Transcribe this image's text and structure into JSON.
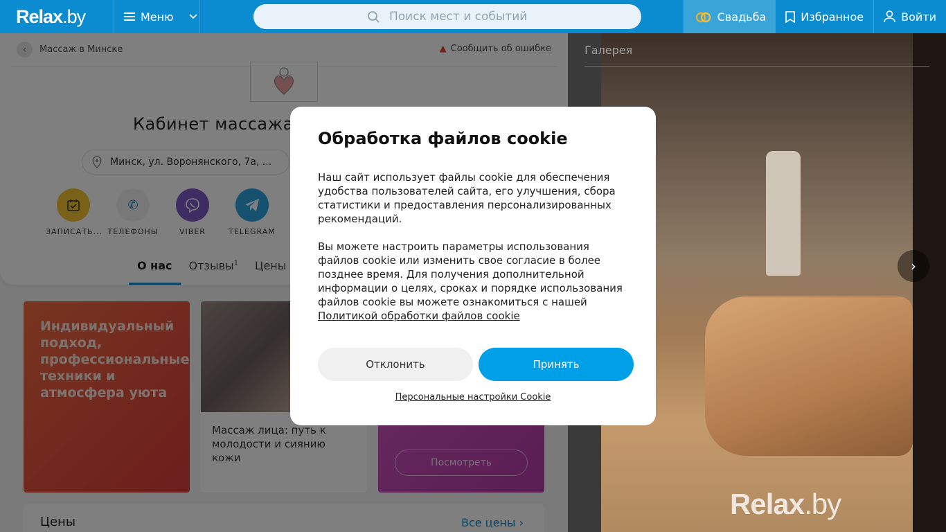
{
  "header": {
    "logo_main": "Relax",
    "logo_dot": ".by",
    "menu_label": "Меню",
    "search_placeholder": "Поиск мест и событий",
    "wedding_label": "Свадьба",
    "favorites_label": "Избранное",
    "login_label": "Войти"
  },
  "venue": {
    "breadcrumb": "Массаж в Минске",
    "report_label": "Сообщить об ошибке",
    "title": "Кабинет массажа",
    "address": "Минск, ул. Воронянского, 7а, ...",
    "actions": [
      {
        "label": "ЗАПИСАТЬ...",
        "color": "#f2c230"
      },
      {
        "label": "ТЕЛЕФОНЫ",
        "color": "#f1f1f1"
      },
      {
        "label": "VIBER",
        "color": "#7d5ac5"
      },
      {
        "label": "TELEGRAM",
        "color": "#2ca5e0"
      }
    ],
    "tabs": {
      "about": "О нас",
      "reviews": "Отзывы",
      "reviews_count": "1",
      "prices": "Цены"
    },
    "promo_text": "Индивидуальный подход, профессиональные техники и атмосфера уюта",
    "article_text": "Массаж лица: путь к молодости и сиянию кожи",
    "view_button": "Посмотреть",
    "prices_title": "Цены",
    "prices_all": "Все цены"
  },
  "gallery": {
    "title": "Галерея",
    "watermark_main": "Relax",
    "watermark_dot": ".by"
  },
  "cookie_modal": {
    "title": "Обработка файлов cookie",
    "paragraph1": "Наш сайт использует файлы cookie для обеспечения удобства пользователей сайта, его улучшения, сбора статистики и предоставления персонализированных рекомендаций.",
    "paragraph2": "Вы можете настроить параметры использования файлов cookie или изменить свое согласие в более позднее время. Для получения дополнительной информации о целях, сроках и порядке использования файлов cookie вы можете ознакомиться с нашей",
    "policy_link": "Политикой обработки файлов cookie",
    "decline_label": "Отклонить",
    "accept_label": "Принять",
    "personal_settings": "Персональные настройки Cookie",
    "accept_color": "#00a0e8"
  }
}
